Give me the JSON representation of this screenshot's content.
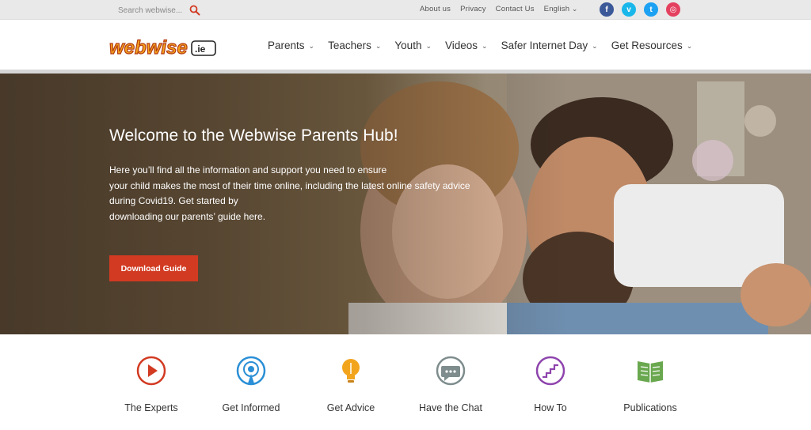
{
  "topbar": {
    "search_placeholder": "Search webwise...",
    "links": [
      "About us",
      "Privacy",
      "Contact Us",
      "English"
    ],
    "social": [
      {
        "name": "facebook-icon",
        "glyph": "f",
        "color": "#3b5998"
      },
      {
        "name": "vimeo-icon",
        "glyph": "v",
        "color": "#1ab7ea"
      },
      {
        "name": "twitter-icon",
        "glyph": "t",
        "color": "#1da1f2"
      },
      {
        "name": "instagram-icon",
        "glyph": "◎",
        "color": "#e4405f"
      }
    ]
  },
  "header": {
    "logo_text": "webwise",
    "logo_suffix": ".ie",
    "nav": [
      "Parents",
      "Teachers",
      "Youth",
      "Videos",
      "Safer Internet Day",
      "Get Resources"
    ]
  },
  "hero": {
    "title": "Welcome to the Webwise Parents Hub!",
    "lines": [
      "Here you’ll find all the information and support you need to ensure",
      "your child makes the most of their time online, including the latest online safety advice",
      "during Covid19. Get started by",
      "downloading our parents’ guide here."
    ],
    "button": "Download Guide"
  },
  "features": [
    {
      "label": "The Experts",
      "icon": "play-icon",
      "color": "#d23a22"
    },
    {
      "label": "Get Informed",
      "icon": "podcast-icon",
      "color": "#2a8fd6"
    },
    {
      "label": "Get Advice",
      "icon": "lightbulb-icon",
      "color": "#f2a51c"
    },
    {
      "label": "Have the Chat",
      "icon": "chat-icon",
      "color": "#7e8c8d"
    },
    {
      "label": "How To",
      "icon": "stairs-icon",
      "color": "#8e44ad"
    },
    {
      "label": "Publications",
      "icon": "book-icon",
      "color": "#6aa84f"
    }
  ],
  "colors": {
    "accent": "#d23a22",
    "topbar": "#e9e9e9"
  }
}
